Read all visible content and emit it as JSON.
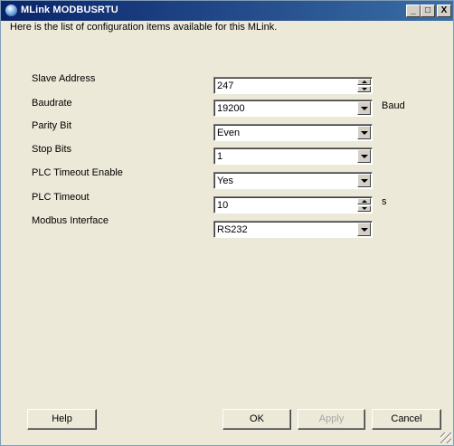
{
  "window": {
    "title": "MLink MODBUSRTU"
  },
  "caption_buttons": {
    "minimize": "_",
    "maximize": "□",
    "close": "X"
  },
  "intro_text": "Here is the list of configuration items available for this MLink.",
  "fields": [
    {
      "label": "Slave Address",
      "value": "247",
      "control": "spin",
      "unit": ""
    },
    {
      "label": "Baudrate",
      "value": "19200",
      "control": "combo",
      "unit": "Baud"
    },
    {
      "label": "Parity Bit",
      "value": "Even",
      "control": "combo",
      "unit": ""
    },
    {
      "label": "Stop Bits",
      "value": "1",
      "control": "combo",
      "unit": ""
    },
    {
      "label": "PLC Timeout Enable",
      "value": "Yes",
      "control": "combo",
      "unit": ""
    },
    {
      "label": "PLC Timeout",
      "value": "10",
      "control": "spin",
      "unit": "s"
    },
    {
      "label": "Modbus Interface",
      "value": "RS232",
      "control": "combo",
      "unit": ""
    }
  ],
  "buttons": {
    "help": "Help",
    "ok": "OK",
    "apply": "Apply",
    "cancel": "Cancel"
  }
}
